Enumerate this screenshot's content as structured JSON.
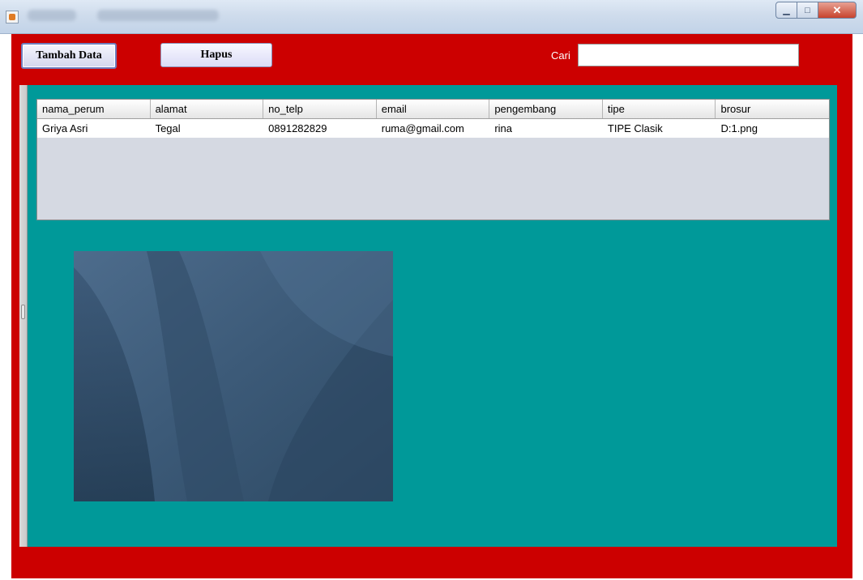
{
  "toolbar": {
    "add_label": "Tambah Data",
    "delete_label": "Hapus",
    "search_label": "Cari",
    "search_value": ""
  },
  "table": {
    "columns": [
      "nama_perum",
      "alamat",
      "no_telp",
      "email",
      "pengembang",
      "tipe",
      "brosur"
    ],
    "rows": [
      [
        "Griya Asri",
        "Tegal",
        "0891282829",
        "ruma@gmail.com",
        "rina",
        "TIPE Clasik",
        "D:1.png"
      ]
    ]
  },
  "colors": {
    "frame": "#cc0000",
    "panel": "#009999",
    "table_empty": "#d5d9e2"
  },
  "icons": {
    "app": "java-icon",
    "minimize": "minimize-icon",
    "maximize": "maximize-icon",
    "close": "close-icon"
  }
}
